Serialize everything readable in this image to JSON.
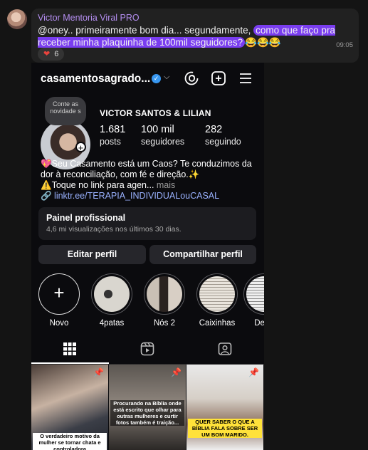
{
  "message": {
    "sender": "Victor Mentoria Viral PRO",
    "text_before": "@oney.. primeiramente bom dia... segundamente, ",
    "text_highlight": "como que faço pra receber minha plaquinha de 100mil seguidores?",
    "emojis": "😂😂😂",
    "time": "09:05",
    "reaction_emoji": "❤",
    "reaction_count": "6"
  },
  "instagram": {
    "username": "casamentosagrado...",
    "note": "Conte as novidade s",
    "full_name": "VICTOR SANTOS & LILIAN",
    "stats": [
      {
        "value": "1.681",
        "label": "posts"
      },
      {
        "value": "100 mil",
        "label": "seguidores"
      },
      {
        "value": "282",
        "label": "seguindo"
      }
    ],
    "bio_line1": "💖Seu Casamento está um Caos? Te conduzimos da dor à reconciliação, com fé e direção.✨",
    "bio_line2": "⚠️Toque no link para agen...",
    "bio_more": " mais",
    "link": "linktr.ee/TERAPIA_INDIVIDUALouCASAL",
    "panel_title": "Painel profissional",
    "panel_sub": "4,6 mi visualizações nos últimos 30 dias.",
    "edit_button": "Editar perfil",
    "share_button": "Compartilhar perfil",
    "highlights": [
      {
        "label": "Novo"
      },
      {
        "label": "4patas"
      },
      {
        "label": "Nós 2"
      },
      {
        "label": "Caixinhas"
      },
      {
        "label": "Depo"
      }
    ],
    "tiles": [
      {
        "caption": "O verdadeiro motivo da mulher se tornar chata e controladora"
      },
      {
        "caption": "Procurando na Bíblia onde está escrito que olhar para outras mulheres e curtir fotos também é traição..."
      },
      {
        "caption": "QUER SABER O QUE A BÍBLIA FALA SOBRE SER UM BOM MARIDO."
      }
    ]
  },
  "colors": {
    "highlight": "#7a3df0",
    "sender": "#b48ef0",
    "verified": "#3897f0",
    "link": "#9ab2ff"
  }
}
